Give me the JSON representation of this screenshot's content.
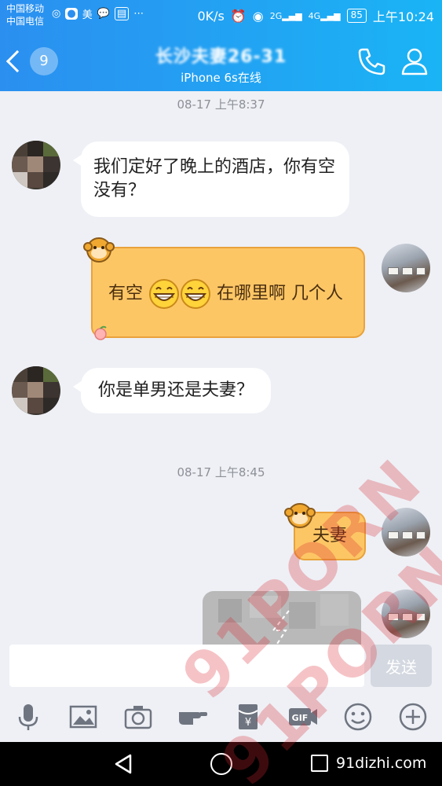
{
  "status_bar": {
    "carrier_1": "中国移动",
    "carrier_2": "中国电信",
    "app_mei": "美",
    "speed": "0K/s",
    "battery": "85",
    "time": "上午10:24",
    "net_2g": "2G",
    "net_4g": "4G"
  },
  "header": {
    "unread_count": "9",
    "title": "长沙夫妻26-31",
    "subtitle": "iPhone 6s在线"
  },
  "chat": {
    "timestamps": [
      "08-17 上午8:37",
      "08-17 上午8:45"
    ],
    "messages": [
      {
        "side": "left",
        "text": "我们定好了晚上的酒店，你有空没有？"
      },
      {
        "side": "right",
        "text_before": "有空",
        "emoji": "laughing-face x2",
        "text_after": "在哪里啊   几个人"
      },
      {
        "side": "left",
        "text": "你是单男还是夫妻？"
      },
      {
        "side": "right",
        "text": "夫妻"
      },
      {
        "side": "right",
        "type": "image",
        "text": ""
      }
    ]
  },
  "input": {
    "value": "",
    "send_label": "发送"
  },
  "toolbar": [
    "microphone-icon",
    "image-icon",
    "camera-icon",
    "poke-hand-icon",
    "red-packet-icon",
    "gif-icon",
    "emoji-icon",
    "plus-icon"
  ],
  "nav": {
    "site_label": "91dizhi.com"
  },
  "watermark": {
    "text": "91PORN"
  },
  "colors": {
    "header_start": "#2b8ff0",
    "header_end": "#1ab4f5",
    "bubble_right": "#fdc665",
    "bubble_right_border": "#e9a23b",
    "background": "#eef0f5"
  }
}
